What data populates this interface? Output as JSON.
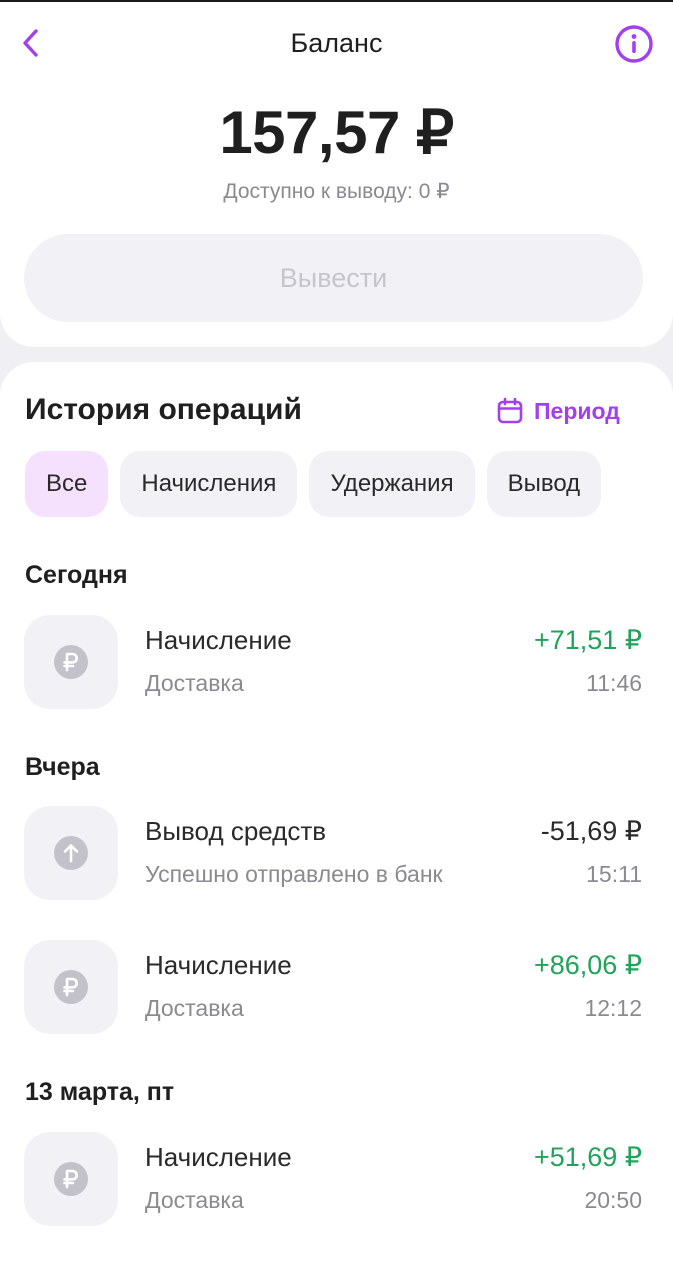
{
  "header": {
    "title": "Баланс",
    "back_icon": "chevron-left-icon",
    "info_icon": "info-icon",
    "accent": "#a23ff0"
  },
  "balance": {
    "amount": "157,57 ₽",
    "available": "Доступно к выводу: 0 ₽",
    "withdraw_label": "Вывести"
  },
  "history": {
    "title": "История операций",
    "period_label": "Период",
    "period_icon": "calendar-icon",
    "filters": [
      {
        "label": "Все",
        "active": true
      },
      {
        "label": "Начисления",
        "active": false
      },
      {
        "label": "Удержания",
        "active": false
      },
      {
        "label": "Вывод",
        "active": false
      }
    ],
    "groups": [
      {
        "label": "Сегодня",
        "items": [
          {
            "icon": "ruble-icon",
            "title": "Начисление",
            "subtitle": "Доставка",
            "amount": "+71,51 ₽",
            "time": "11:46",
            "positive": true
          }
        ]
      },
      {
        "label": "Вчера",
        "items": [
          {
            "icon": "arrow-up-icon",
            "title": "Вывод средств",
            "subtitle": "Успешно отправлено в банк",
            "amount": "-51,69 ₽",
            "time": "15:11",
            "positive": false
          },
          {
            "icon": "ruble-icon",
            "title": "Начисление",
            "subtitle": "Доставка",
            "amount": "+86,06 ₽",
            "time": "12:12",
            "positive": true
          }
        ]
      },
      {
        "label": "13 марта, пт",
        "items": [
          {
            "icon": "ruble-icon",
            "title": "Начисление",
            "subtitle": "Доставка",
            "amount": "+51,69 ₽",
            "time": "20:50",
            "positive": true
          }
        ]
      }
    ],
    "positive_color": "#20a35a"
  }
}
